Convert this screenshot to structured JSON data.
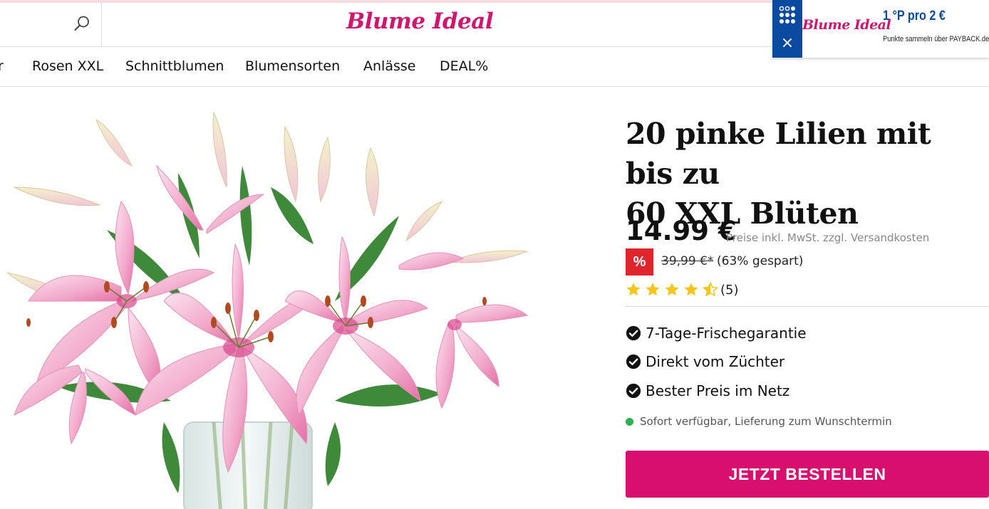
{
  "header": {
    "logo_text": "Blume Ideal"
  },
  "payback": {
    "logo_text": "Blume Ideal",
    "points": "1 °P pro 2 €",
    "subtext": "Punkte sammeln über PAYBACK.de",
    "close": "×",
    "brand_color": "#0a4aa0"
  },
  "nav": {
    "items": [
      {
        "label": "r"
      },
      {
        "label": "Rosen XXL"
      },
      {
        "label": "Schnittblumen"
      },
      {
        "label": "Blumensorten"
      },
      {
        "label": "Anlässe"
      },
      {
        "label": "DEAL%"
      }
    ]
  },
  "product": {
    "title_line1": "20 pinke Lilien mit bis zu",
    "title_line2": "60 XXL Blüten",
    "price": "14.99 €",
    "price_note": "Preise inkl. MwSt. zzgl. Versandkosten",
    "sale_badge": "%",
    "old_price": "39,99 €*",
    "saved": "(63% gespart)",
    "rating": 4.5,
    "rating_max": 5,
    "rating_count": "(5)",
    "features": [
      {
        "label": "7-Tage-Frischegarantie"
      },
      {
        "label": "Direkt vom Züchter"
      },
      {
        "label": "Bester Preis im Netz"
      }
    ],
    "availability": "Sofort verfügbar, Lieferung zum Wunschtermin",
    "order_button": "JETZT BESTELLEN"
  },
  "colors": {
    "brand_pink": "#d80f6f",
    "logo_pink": "#d0166f",
    "sale_red": "#e0242e",
    "star_yellow": "#f5c518",
    "available_green": "#2bb24c"
  }
}
